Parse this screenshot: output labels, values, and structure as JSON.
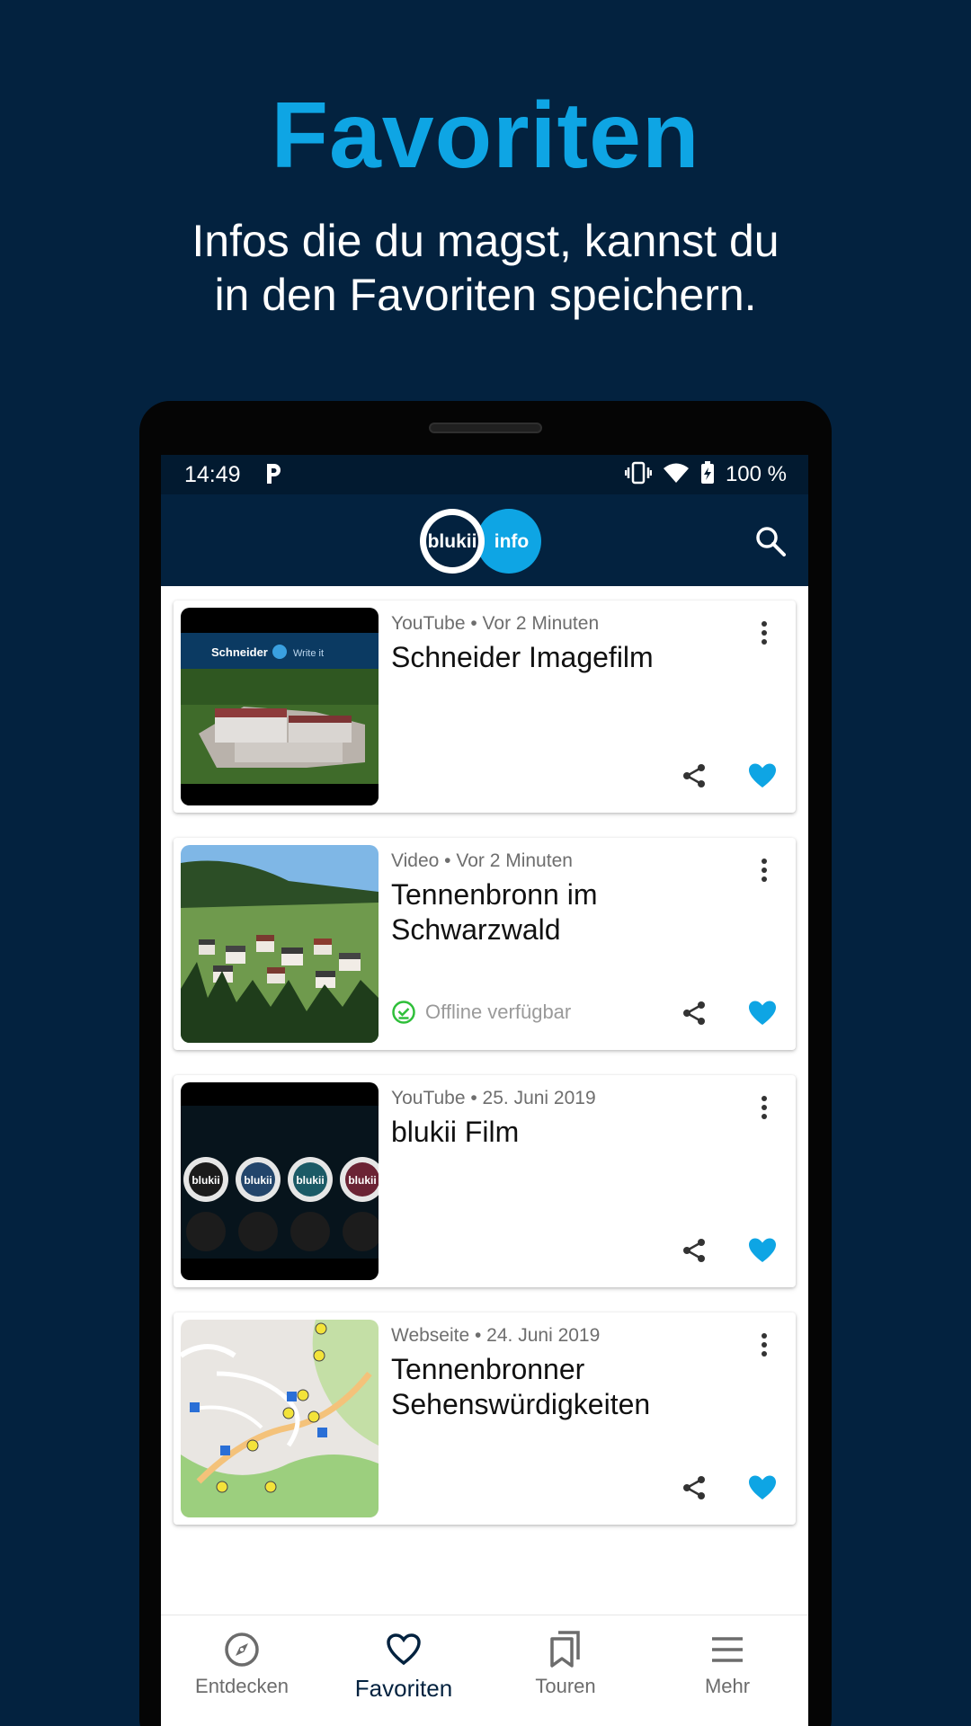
{
  "hero": {
    "title": "Favoriten",
    "subtitle_line1": "Infos die du magst, kannst du",
    "subtitle_line2": "in den Favoriten speichern."
  },
  "status_bar": {
    "time": "14:49",
    "battery": "100 %"
  },
  "app_bar": {
    "logo_left": "blukii",
    "logo_right": "info"
  },
  "items": [
    {
      "meta": "YouTube • Vor 2 Minuten",
      "title": "Schneider Imagefilm",
      "thumb_label": "Schneider",
      "thumb_label2": "Write it",
      "offline": ""
    },
    {
      "meta": "Video • Vor 2 Minuten",
      "title": "Tennenbronn im Schwarzwald",
      "offline": "Offline verfügbar"
    },
    {
      "meta": "YouTube • 25. Juni 2019",
      "title": "blukii Film",
      "thumb_label": "blukii",
      "offline": ""
    },
    {
      "meta": "Webseite • 24. Juni 2019",
      "title": "Tennenbronner Sehenswürdigkeiten",
      "offline": ""
    }
  ],
  "bottom_nav": [
    {
      "label": "Entdecken",
      "icon": "compass-icon"
    },
    {
      "label": "Favoriten",
      "icon": "heart-outline-icon",
      "active": true
    },
    {
      "label": "Touren",
      "icon": "bookmarks-icon"
    },
    {
      "label": "Mehr",
      "icon": "menu-icon"
    }
  ],
  "colors": {
    "background": "#03223f",
    "accent": "#0ea5e4",
    "offline_green": "#2fbf3a"
  }
}
